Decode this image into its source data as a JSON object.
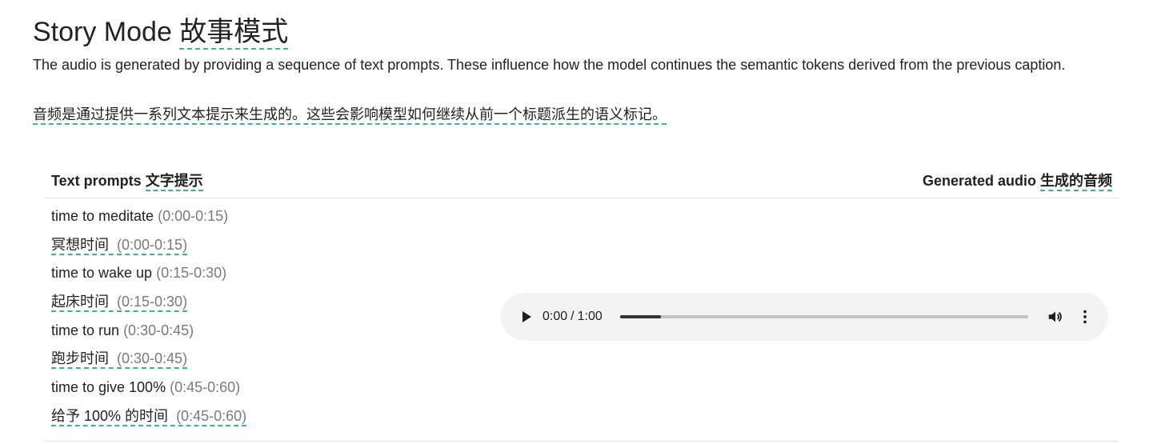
{
  "header": {
    "title_en": "Story Mode",
    "title_zh": "故事模式",
    "description_en": "The audio is generated by providing a sequence of text prompts. These influence how the model continues the semantic tokens derived from the previous caption.",
    "description_zh": "音频是通过提供一系列文本提示来生成的。这些会影响模型如何继续从前一个标题派生的语义标记。"
  },
  "table": {
    "col_prompts_en": "Text prompts",
    "col_prompts_zh": "文字提示",
    "col_audio_en": "Generated audio",
    "col_audio_zh": "生成的音频",
    "prompts": [
      {
        "text": "time to meditate",
        "time": "(0:00-0:15)",
        "lang": "en"
      },
      {
        "text": "冥想时间",
        "time": "(0:00-0:15)",
        "lang": "zh"
      },
      {
        "text": "time to wake up",
        "time": "(0:15-0:30)",
        "lang": "en"
      },
      {
        "text": "起床时间",
        "time": "(0:15-0:30)",
        "lang": "zh"
      },
      {
        "text": "time to run",
        "time": "(0:30-0:45)",
        "lang": "en"
      },
      {
        "text": "跑步时间",
        "time": "(0:30-0:45)",
        "lang": "zh"
      },
      {
        "text": "time to give 100%",
        "time": "(0:45-0:60)",
        "lang": "en"
      },
      {
        "text": "给予 100% 的时间",
        "time": "(0:45-0:60)",
        "lang": "zh"
      }
    ]
  },
  "audio_player": {
    "current_time": "0:00",
    "separator": "/",
    "duration": "1:00",
    "buffered_fraction": 0.1,
    "icons": [
      "play-icon",
      "volume-icon",
      "more-vertical-icon"
    ]
  },
  "colors": {
    "accent_underline": "#3bb0a9",
    "player_bg": "#f1f3f4",
    "muted_text": "#7a7a7a"
  }
}
